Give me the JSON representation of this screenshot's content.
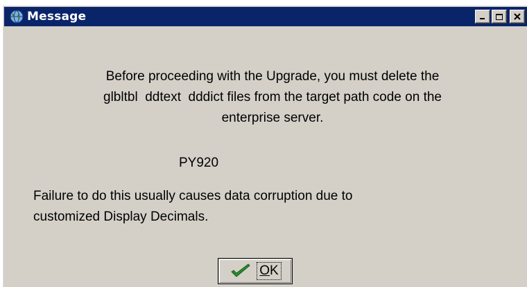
{
  "window": {
    "title": "Message",
    "app_icon": "globe-icon",
    "controls": [
      "minimize-icon",
      "maximize-icon",
      "close-icon"
    ]
  },
  "message": {
    "line1": "Before proceeding with the Upgrade, you must delete the",
    "line2": "glbltbl  ddtext  dddict files from the target path code on the",
    "line3": "enterprise server.",
    "path_code": "PY920",
    "warning_line1": "Failure to do this usually causes data corruption due to",
    "warning_line2": "customized Display Decimals."
  },
  "ok_button": {
    "icon": "checkmark-icon",
    "mnemonic": "O",
    "label_rest": "K",
    "accent": "#2e8b2e"
  }
}
